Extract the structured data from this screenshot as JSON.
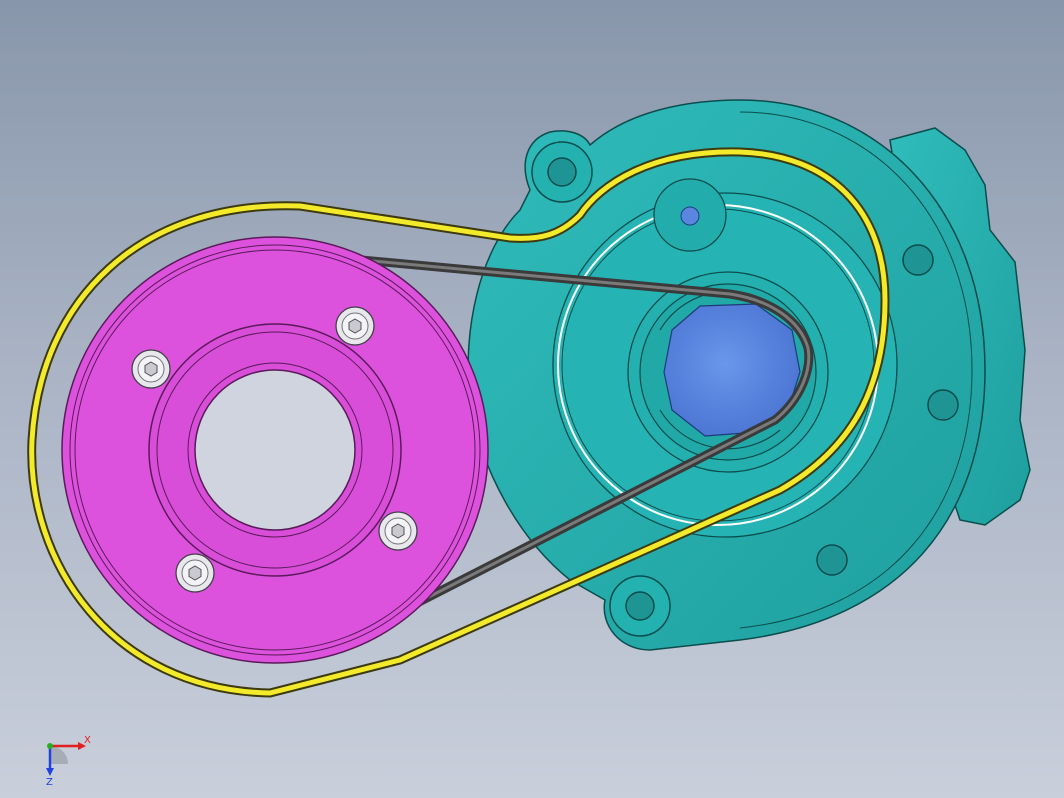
{
  "viewport": {
    "background_top": "#8896ab",
    "background_bottom": "#c9cfdb"
  },
  "model": {
    "components": [
      {
        "name": "pulley-disc",
        "color": "#dd52dd"
      },
      {
        "name": "housing",
        "color": "#22adac"
      },
      {
        "name": "drive-hub",
        "color": "#5080dc"
      },
      {
        "name": "outer-belt",
        "color": "#f2ea2a"
      },
      {
        "name": "inner-belt",
        "color": "#555555"
      },
      {
        "name": "socket-screw",
        "count": 4,
        "color": "#e8e8ec"
      }
    ]
  },
  "triad": {
    "x_label": "X",
    "z_label": "Z",
    "x_color": "#e02020",
    "y_color": "#20b020",
    "z_color": "#2040e0"
  }
}
